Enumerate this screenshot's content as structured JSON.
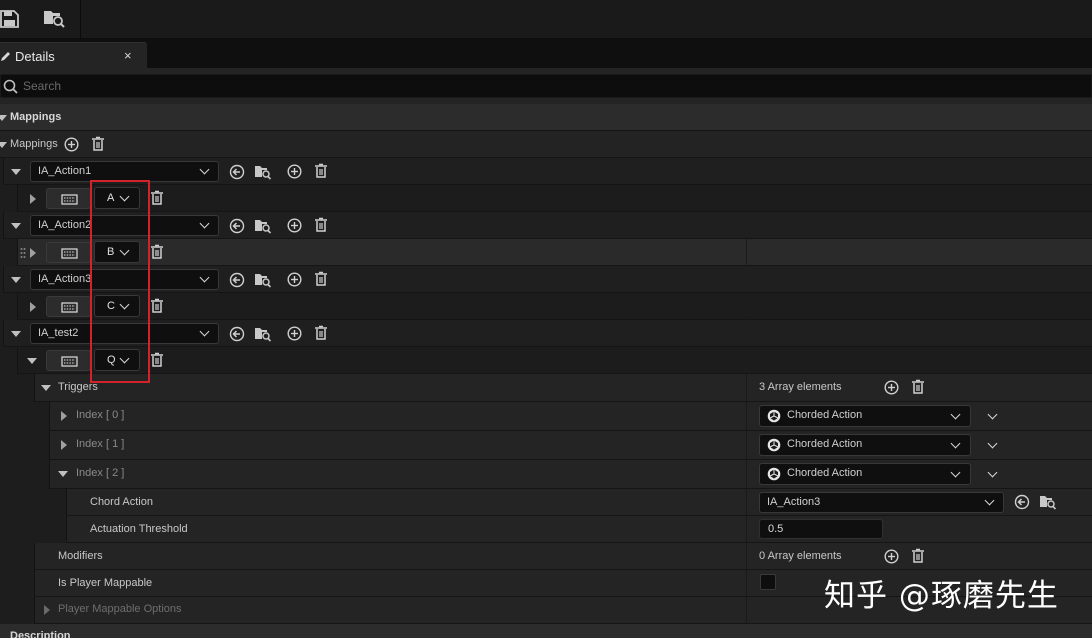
{
  "tab": {
    "title": "Details",
    "close": "×"
  },
  "search": {
    "placeholder": "Search"
  },
  "sections": {
    "mappings_header": "Mappings",
    "mappings_label": "Mappings",
    "description_header": "Description"
  },
  "actions": [
    {
      "name": "IA_Action1",
      "key": "A"
    },
    {
      "name": "IA_Action2",
      "key": "B"
    },
    {
      "name": "IA_Action3",
      "key": "C"
    },
    {
      "name": "IA_test2",
      "key": "Q"
    }
  ],
  "triggers": {
    "label": "Triggers",
    "count": "3 Array elements",
    "items": [
      {
        "index": "Index [ 0 ]",
        "value": "Chorded Action"
      },
      {
        "index": "Index [ 1 ]",
        "value": "Chorded Action"
      },
      {
        "index": "Index [ 2 ]",
        "value": "Chorded Action"
      }
    ]
  },
  "chord_action": {
    "label": "Chord Action",
    "value": "IA_Action3"
  },
  "actuation_threshold": {
    "label": "Actuation Threshold",
    "value": "0.5"
  },
  "modifiers": {
    "label": "Modifiers",
    "count": "0 Array elements"
  },
  "is_player_mappable": {
    "label": "Is Player Mappable",
    "checked": false
  },
  "player_mappable_options": {
    "label": "Player Mappable Options"
  },
  "watermark": "知乎 @琢磨先生",
  "colors": {
    "highlight": "#d2232a",
    "background": "#151515",
    "panel": "#242424"
  }
}
